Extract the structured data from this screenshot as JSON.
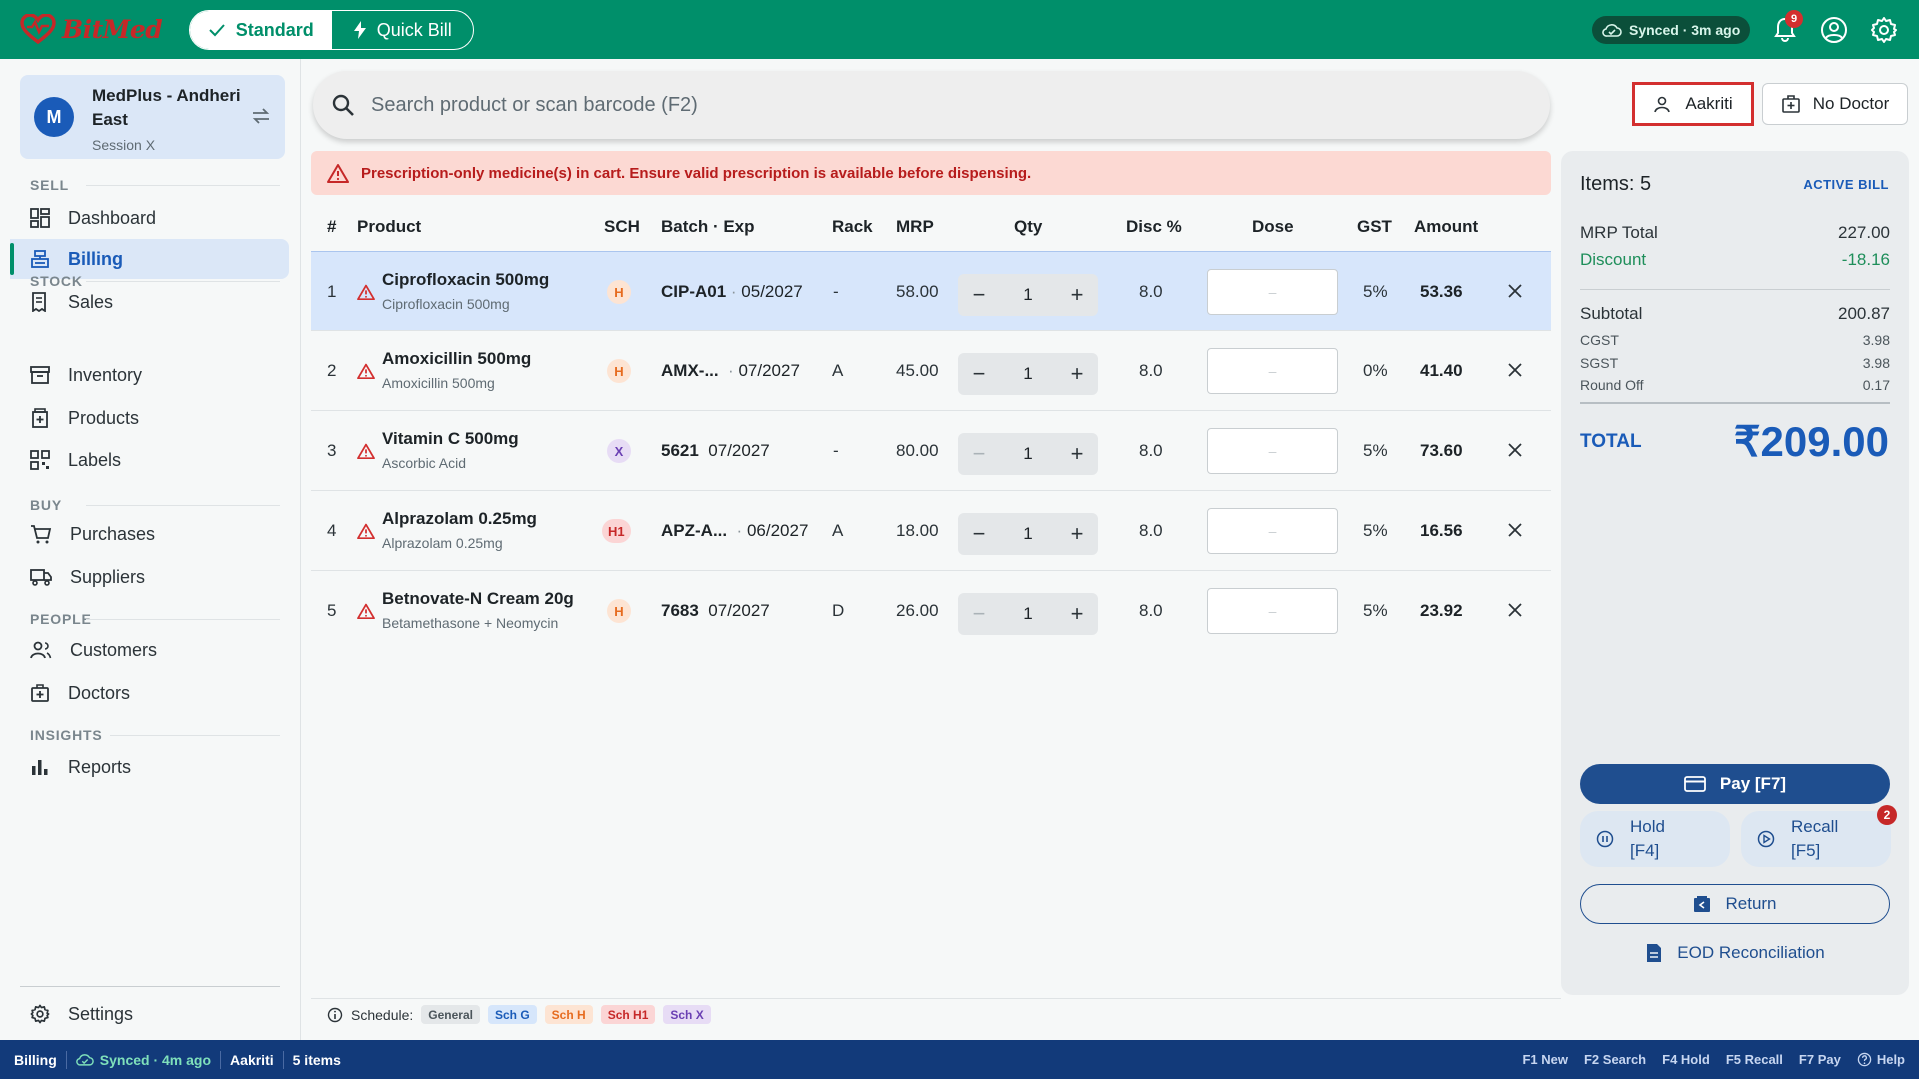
{
  "app": {
    "brand": "BitMed",
    "modes": [
      {
        "label": "Standard",
        "active": true
      },
      {
        "label": "Quick Bill",
        "active": false
      }
    ],
    "sync_status": "Synced · 3m ago",
    "notification_count": "9",
    "colors": {
      "brand_green": "#008f6a",
      "accent_blue": "#1a5bb8",
      "alert_red": "#d32f2f",
      "status_bar": "#123a7a"
    }
  },
  "sidebar": {
    "store": {
      "avatar": "M",
      "name": "MedPlus - Andheri East",
      "session": "Session X"
    },
    "sections": {
      "sell": "SELL",
      "stock": "STOCK",
      "buy": "BUY",
      "people": "PEOPLE",
      "insights": "INSIGHTS"
    },
    "items": {
      "dashboard": "Dashboard",
      "billing": "Billing",
      "sales": "Sales",
      "inventory": "Inventory",
      "products": "Products",
      "labels": "Labels",
      "purchases": "Purchases",
      "suppliers": "Suppliers",
      "customers": "Customers",
      "doctors": "Doctors",
      "reports": "Reports",
      "settings": "Settings"
    },
    "active_item": "billing"
  },
  "search": {
    "placeholder": "Search product or scan barcode (F2)",
    "value": ""
  },
  "patient": {
    "label": "Aakriti"
  },
  "doctor": {
    "label": "No Doctor"
  },
  "alert": {
    "text": "Prescription-only medicine(s) in cart. Ensure valid prescription is available before dispensing."
  },
  "table": {
    "headers": {
      "num": "#",
      "product": "Product",
      "sch": "SCH",
      "batch_exp": "Batch · Exp",
      "rack": "Rack",
      "mrp": "MRP",
      "qty": "Qty",
      "disc": "Disc %",
      "dose": "Dose",
      "gst": "GST",
      "amount": "Amount"
    },
    "rows": [
      {
        "num": "1",
        "name": "Ciprofloxacin 500mg",
        "generic": "Ciprofloxacin 500mg",
        "sch": "H",
        "batch": "CIP-A01",
        "exp": "05/2027",
        "rack": "-",
        "mrp": "58.00",
        "qty": "1",
        "disc": "8.0",
        "dose": "–",
        "gst": "5%",
        "amount": "53.36",
        "selected": true
      },
      {
        "num": "2",
        "name": "Amoxicillin 500mg",
        "generic": "Amoxicillin 500mg",
        "sch": "H",
        "batch": "AMX-...",
        "exp": "07/2027",
        "rack": "A",
        "mrp": "45.00",
        "qty": "1",
        "disc": "8.0",
        "dose": "–",
        "gst": "0%",
        "amount": "41.40",
        "selected": false
      },
      {
        "num": "3",
        "name": "Vitamin C 500mg",
        "generic": "Ascorbic Acid",
        "sch": "X",
        "batch": "5621",
        "exp": "07/2027",
        "rack": "-",
        "mrp": "80.00",
        "qty": "1",
        "disc": "8.0",
        "dose": "–",
        "gst": "5%",
        "amount": "73.60",
        "selected": false
      },
      {
        "num": "4",
        "name": "Alprazolam 0.25mg",
        "generic": "Alprazolam 0.25mg",
        "sch": "H1",
        "batch": "APZ-A...",
        "exp": "06/2027",
        "rack": "A",
        "mrp": "18.00",
        "qty": "1",
        "disc": "8.0",
        "dose": "–",
        "gst": "5%",
        "amount": "16.56",
        "selected": false
      },
      {
        "num": "5",
        "name": "Betnovate-N Cream 20g",
        "generic": "Betamethasone + Neomycin",
        "sch": "H",
        "batch": "7683",
        "exp": "07/2027",
        "rack": "D",
        "mrp": "26.00",
        "qty": "1",
        "disc": "8.0",
        "dose": "–",
        "gst": "5%",
        "amount": "23.92",
        "selected": false
      }
    ]
  },
  "legend": {
    "label": "Schedule:",
    "chips": [
      "General",
      "Sch G",
      "Sch H",
      "Sch H1",
      "Sch X"
    ]
  },
  "summary": {
    "items_label": "Items: 5",
    "status": "ACTIVE BILL",
    "mrp_total_label": "MRP Total",
    "mrp_total": "227.00",
    "discount_label": "Discount",
    "discount": "-18.16",
    "subtotal_label": "Subtotal",
    "subtotal": "200.87",
    "cgst_label": "CGST",
    "cgst": "3.98",
    "sgst_label": "SGST",
    "sgst": "3.98",
    "round_off_label": "Round Off",
    "round_off": "0.17",
    "total_label": "TOTAL",
    "total": "₹209.00",
    "pay_label": "Pay  [F7]",
    "hold_label": "Hold",
    "hold_key": "[F4]",
    "recall_label": "Recall",
    "recall_key": "[F5]",
    "recall_count": "2",
    "return_label": "Return",
    "eod_label": "EOD Reconciliation"
  },
  "statusbar": {
    "page": "Billing",
    "sync": "Synced · 4m ago",
    "patient": "Aakriti",
    "items": "5 items",
    "shortcuts": [
      "F1 New",
      "F2 Search",
      "F4 Hold",
      "F5 Recall",
      "F7 Pay"
    ],
    "help": "Help"
  }
}
